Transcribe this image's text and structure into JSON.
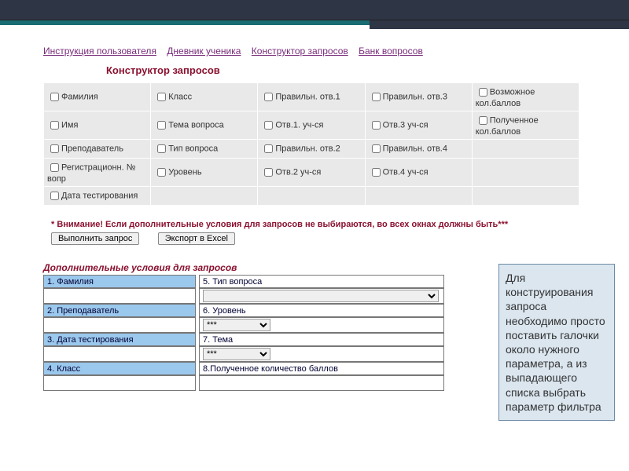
{
  "nav": {
    "instructions": "Инструкция пользователя",
    "diary": "Дневник ученика",
    "builder": "Конструктор запросов",
    "bank": "Банк вопросов"
  },
  "page_title": "Конструктор запросов",
  "params": {
    "c0r0": "Фамилия",
    "c0r1": "Имя",
    "c0r2": "Преподаватель",
    "c0r3": "Регистрационн. № вопр",
    "c0r4": "Дата тестирования",
    "c1r0": "Класс",
    "c1r1": "Тема вопроса",
    "c1r2": "Тип вопроса",
    "c1r3": "Уровень",
    "c2r0": "Правильн. отв.1",
    "c2r1": "Отв.1. уч-ся",
    "c2r2": "Правильн. отв.2",
    "c2r3": "Отв.2 уч-ся",
    "c3r0": "Правильн. отв.3",
    "c3r1": "Отв.3 уч-ся",
    "c3r2": "Правильн. отв.4",
    "c3r3": "Отв.4 уч-ся",
    "c4r0": "Возможное кол.баллов",
    "c4r1": "Полученное кол.баллов"
  },
  "warning": "* Внимание! Если дополнительные условия для запросов не выбираются, во всех окнах должны быть***",
  "buttons": {
    "run": "Выполнить запрос",
    "export": "Экспорт в Excel"
  },
  "conditions_title": "Дополнительные условия для запросов",
  "cond": {
    "l1": "1. Фамилия",
    "l2": "2. Преподаватель",
    "l3": "3. Дата тестирования",
    "l4": "4. Класс",
    "r5": "5. Тип вопроса",
    "r6": "6. Уровень",
    "r7": "7. Тема",
    "r8": "8.Полученное количество  баллов",
    "star": "***"
  },
  "callout": "Для конструирования запроса необходимо просто поставить галочки около нужного параметра, а из выпадающего списка выбрать  параметр фильтра"
}
